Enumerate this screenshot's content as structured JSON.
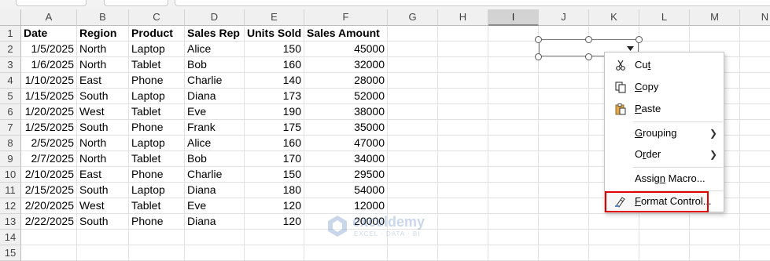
{
  "columns": [
    "A",
    "B",
    "C",
    "D",
    "E",
    "F",
    "G",
    "H",
    "I",
    "J",
    "K",
    "L",
    "M",
    "N"
  ],
  "selected_column": "I",
  "row_numbers": [
    "1",
    "2",
    "3",
    "4",
    "5",
    "6",
    "7",
    "8",
    "9",
    "10",
    "11",
    "12",
    "13",
    "14",
    "15"
  ],
  "table": {
    "headers": [
      "Date",
      "Region",
      "Product",
      "Sales Rep",
      "Units Sold",
      "Sales Amount"
    ],
    "rows": [
      [
        "1/5/2025",
        "North",
        "Laptop",
        "Alice",
        "150",
        "45000"
      ],
      [
        "1/6/2025",
        "North",
        "Tablet",
        "Bob",
        "160",
        "32000"
      ],
      [
        "1/10/2025",
        "East",
        "Phone",
        "Charlie",
        "140",
        "28000"
      ],
      [
        "1/15/2025",
        "South",
        "Laptop",
        "Diana",
        "173",
        "52000"
      ],
      [
        "1/20/2025",
        "West",
        "Tablet",
        "Eve",
        "190",
        "38000"
      ],
      [
        "1/25/2025",
        "South",
        "Phone",
        "Frank",
        "175",
        "35000"
      ],
      [
        "2/5/2025",
        "North",
        "Laptop",
        "Alice",
        "160",
        "47000"
      ],
      [
        "2/7/2025",
        "North",
        "Tablet",
        "Bob",
        "170",
        "34000"
      ],
      [
        "2/10/2025",
        "East",
        "Phone",
        "Charlie",
        "150",
        "29500"
      ],
      [
        "2/15/2025",
        "South",
        "Laptop",
        "Diana",
        "180",
        "54000"
      ],
      [
        "2/20/2025",
        "West",
        "Tablet",
        "Eve",
        "120",
        "12000"
      ],
      [
        "2/22/2025",
        "South",
        "Phone",
        "Diana",
        "120",
        "20000"
      ]
    ]
  },
  "watermark": {
    "name": "exceldemy",
    "tagline": "EXCEL · DATA · BI"
  },
  "context_menu": {
    "items": [
      {
        "label": "Cut",
        "icon": "scissors-icon"
      },
      {
        "label": "Copy",
        "icon": "copy-icon"
      },
      {
        "label": "Paste",
        "icon": "clipboard-icon"
      },
      {
        "label": "Grouping",
        "submenu": true
      },
      {
        "label": "Order",
        "submenu": true
      },
      {
        "label": "Assign Macro..."
      },
      {
        "label": "Format Control...",
        "icon": "format-control-icon",
        "highlighted": true
      }
    ]
  },
  "colors": {
    "highlight_border": "#e00000",
    "header_bg": "#f0f0f0",
    "selected_header_bg": "#d3d3d3"
  }
}
